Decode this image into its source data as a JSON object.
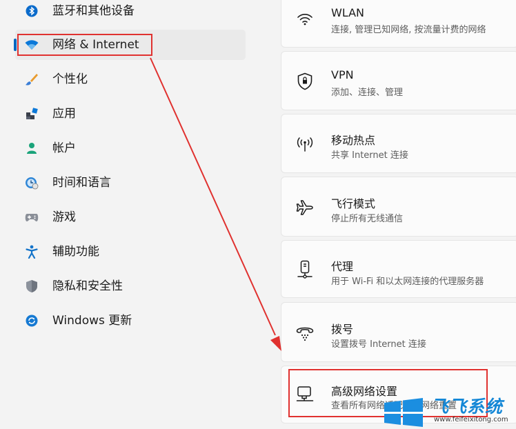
{
  "sidebar": {
    "items": [
      {
        "label": "蓝牙和其他设备",
        "icon": "bluetooth-icon",
        "active": false
      },
      {
        "label": "网络 & Internet",
        "icon": "wifi-icon",
        "active": true
      },
      {
        "label": "个性化",
        "icon": "brush-icon",
        "active": false
      },
      {
        "label": "应用",
        "icon": "apps-icon",
        "active": false
      },
      {
        "label": "帐户",
        "icon": "person-icon",
        "active": false
      },
      {
        "label": "时间和语言",
        "icon": "globe-clock-icon",
        "active": false
      },
      {
        "label": "游戏",
        "icon": "gamepad-icon",
        "active": false
      },
      {
        "label": "辅助功能",
        "icon": "accessibility-icon",
        "active": false
      },
      {
        "label": "隐私和安全性",
        "icon": "shield-icon",
        "active": false
      },
      {
        "label": "Windows 更新",
        "icon": "update-icon",
        "active": false
      }
    ]
  },
  "cards": [
    {
      "title": "WLAN",
      "subtitle": "连接, 管理已知网络, 按流量计费的网络",
      "icon": "wifi-icon"
    },
    {
      "title": "VPN",
      "subtitle": "添加、连接、管理",
      "icon": "vpn-shield-icon"
    },
    {
      "title": "移动热点",
      "subtitle": "共享 Internet 连接",
      "icon": "hotspot-icon"
    },
    {
      "title": "飞行模式",
      "subtitle": "停止所有无线通信",
      "icon": "airplane-icon"
    },
    {
      "title": "代理",
      "subtitle": "用于 Wi-Fi 和以太网连接的代理服务器",
      "icon": "proxy-icon"
    },
    {
      "title": "拨号",
      "subtitle": "设置拨号 Internet 连接",
      "icon": "dialup-icon"
    },
    {
      "title": "高级网络设置",
      "subtitle": "查看所有网络适配器，网络重置",
      "icon": "network-pc-icon"
    }
  ],
  "watermark": {
    "text": "飞飞系统",
    "url": "www.feifeixitong.com"
  },
  "colors": {
    "accent": "#0067c0",
    "highlight": "#e0312f",
    "watermark": "#1487d6"
  }
}
